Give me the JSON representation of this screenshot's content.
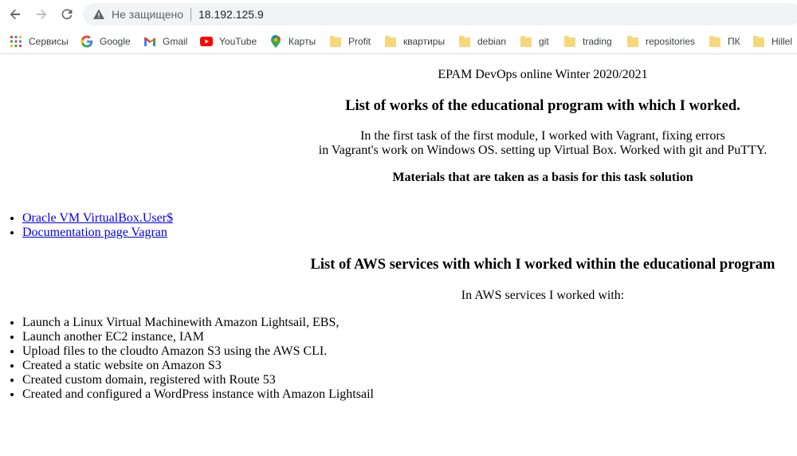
{
  "browser": {
    "security_label": "Не защищено",
    "url": "18.192.125.9",
    "bookmarks": [
      {
        "label": "Сервисы",
        "icon": "apps-grid-icon"
      },
      {
        "label": "Google",
        "icon": "google-icon"
      },
      {
        "label": "Gmail",
        "icon": "gmail-icon"
      },
      {
        "label": "YouTube",
        "icon": "youtube-icon"
      },
      {
        "label": "Карты",
        "icon": "maps-pin-icon"
      },
      {
        "label": "Profit",
        "icon": "folder-icon"
      },
      {
        "label": "квартиры",
        "icon": "folder-icon"
      },
      {
        "label": "debian",
        "icon": "folder-icon"
      },
      {
        "label": "git",
        "icon": "folder-icon"
      },
      {
        "label": "trading",
        "icon": "folder-icon"
      },
      {
        "label": "repositories",
        "icon": "folder-icon"
      },
      {
        "label": "ПК",
        "icon": "folder-icon"
      },
      {
        "label": "Hillel",
        "icon": "folder-icon"
      }
    ]
  },
  "page": {
    "course": "EPAM DevOps online Winter 2020/2021",
    "works_heading": "List of works of the educational program with which I worked.",
    "intro_line1": "In the first task of the first module, I worked with Vagrant, fixing errors",
    "intro_line2": "in Vagrant's work on Windows OS. setting up Virtual Box. Worked with git and PuTTY.",
    "materials_heading": "Materials that are taken as a basis for this task solution",
    "links": [
      "Oracle VM VirtualBox.User$",
      "Documentation page Vagran"
    ],
    "aws_heading": "List of AWS services with which I worked within the educational program",
    "aws_intro": "In AWS services I worked with:",
    "aws_items": [
      "Launch a Linux Virtual Machinewith Amazon Lightsail, EBS,",
      "Launch another EC2 instance, IAM",
      "Upload files to the cloudto Amazon S3 using the AWS CLI.",
      "Created a static website on Amazon S3",
      "Created custom domain, registered with Route 53",
      "Created and configured a WordPress instance with Amazon Lightsail"
    ]
  }
}
